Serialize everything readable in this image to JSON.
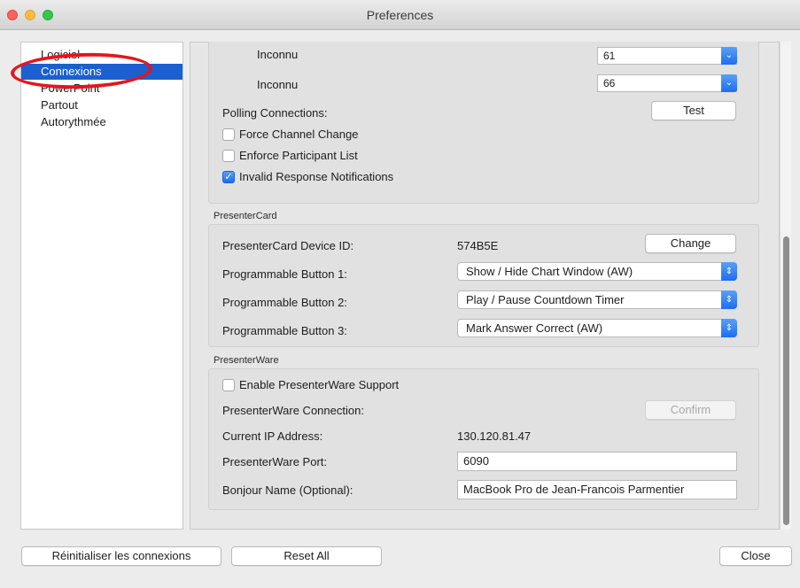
{
  "window": {
    "title": "Preferences"
  },
  "sidebar": {
    "items": [
      {
        "label": "Logiciel"
      },
      {
        "label": "Connexions"
      },
      {
        "label": "PowerPoint"
      },
      {
        "label": "Partout"
      },
      {
        "label": "Autorythmée"
      }
    ],
    "selected": "Connexions",
    "annotation": "red-circle-around-connexions"
  },
  "connections": {
    "unknown1_label": "Inconnu",
    "unknown1_value": "61",
    "unknown2_label": "Inconnu",
    "unknown2_value": "66",
    "polling_label": "Polling Connections:",
    "test_button": "Test",
    "force_channel": {
      "label": "Force Channel Change",
      "checked": false
    },
    "enforce_participant": {
      "label": "Enforce Participant List",
      "checked": false
    },
    "invalid_response": {
      "label": "Invalid Response Notifications",
      "checked": true
    }
  },
  "presentercard": {
    "section_title": "PresenterCard",
    "device_id_label": "PresenterCard Device ID:",
    "device_id_value": "574B5E",
    "change_button": "Change",
    "button1_label": "Programmable Button 1:",
    "button1_value": "Show / Hide Chart Window (AW)",
    "button2_label": "Programmable Button 2:",
    "button2_value": "Play / Pause Countdown Timer",
    "button3_label": "Programmable Button 3:",
    "button3_value": "Mark Answer Correct (AW)"
  },
  "presenterware": {
    "section_title": "PresenterWare",
    "enable_support": {
      "label": "Enable PresenterWare Support",
      "checked": false
    },
    "connection_label": "PresenterWare Connection:",
    "confirm_button": "Confirm",
    "ip_label": "Current IP Address:",
    "ip_value": "130.120.81.47",
    "port_label": "PresenterWare Port:",
    "port_value": "6090",
    "bonjour_label": "Bonjour Name (Optional):",
    "bonjour_value": "MacBook Pro de Jean-Francois Parmentier"
  },
  "footer": {
    "reset_connections_button": "Réinitialiser les connexions",
    "reset_all_button": "Reset All",
    "close_button": "Close"
  },
  "colors": {
    "selection": "#1b5fd1",
    "accent_blue": "#1d6ef0",
    "annotation_red": "#e8141b"
  }
}
